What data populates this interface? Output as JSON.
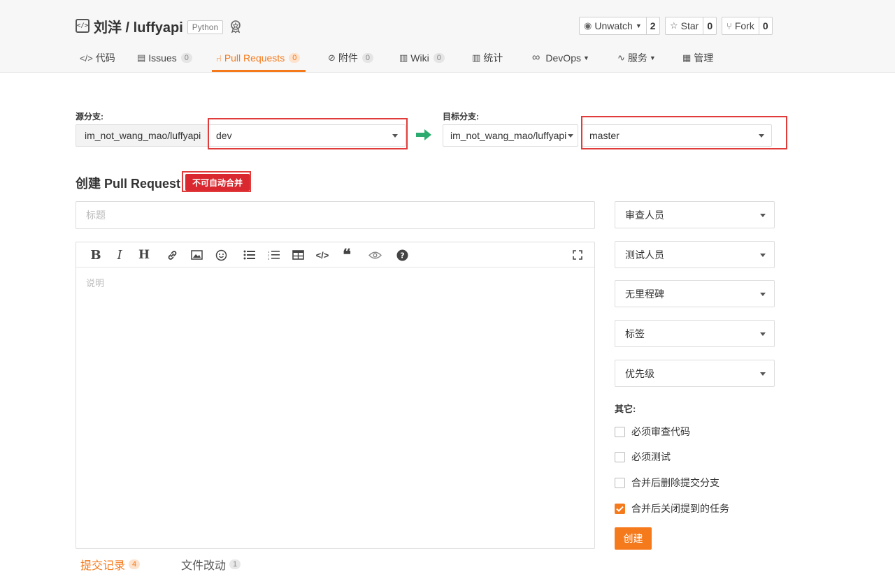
{
  "repo": {
    "owner_name": "刘洋 / luffyapi",
    "language": "Python",
    "icon": "code-bracket-icon",
    "award_icon": "award-ribbon-icon"
  },
  "actions": {
    "watch": {
      "label": "Unwatch",
      "count": "2",
      "icon": "eye-icon"
    },
    "star": {
      "label": "Star",
      "count": "0",
      "icon": "star-icon"
    },
    "fork": {
      "label": "Fork",
      "count": "0",
      "icon": "fork-icon"
    }
  },
  "nav": [
    {
      "label": "代码",
      "icon": "code-icon"
    },
    {
      "label": "Issues",
      "badge": "0",
      "icon": "issues-icon"
    },
    {
      "label": "Pull Requests",
      "badge": "0",
      "icon": "pull-request-icon",
      "active": true
    },
    {
      "label": "附件",
      "badge": "0",
      "icon": "paperclip-icon"
    },
    {
      "label": "Wiki",
      "badge": "0",
      "icon": "book-icon"
    },
    {
      "label": "统计",
      "icon": "bar-chart-icon"
    },
    {
      "label": "DevOps",
      "icon": "infinity-icon"
    },
    {
      "label": "服务",
      "icon": "pulse-icon"
    },
    {
      "label": "管理",
      "icon": "document-icon"
    }
  ],
  "branches": {
    "source_label": "源分支:",
    "source_repo": "im_not_wang_mao/luffyapi",
    "source_branch": "dev",
    "target_label": "目标分支:",
    "target_repo": "im_not_wang_mao/luffyapi",
    "target_branch": "master"
  },
  "form": {
    "heading": "创建 Pull Request",
    "merge_status": "不可自动合并",
    "title_placeholder": "标题",
    "description_placeholder": "说明"
  },
  "toolbar": [
    "bold-icon",
    "italic-icon",
    "heading-icon",
    "link-icon",
    "image-icon",
    "emoji-icon",
    "bullet-list-icon",
    "numbered-list-icon",
    "table-icon",
    "code-icon",
    "quote-icon",
    "preview-eye-icon",
    "help-icon",
    "fullscreen-icon"
  ],
  "sidebar": {
    "reviewers": "审查人员",
    "testers": "测试人员",
    "milestone": "无里程碑",
    "labels": "标签",
    "priority": "优先级",
    "other_label": "其它:",
    "options": [
      {
        "label": "必须审查代码",
        "checked": false
      },
      {
        "label": "必须测试",
        "checked": false
      },
      {
        "label": "合并后删除提交分支",
        "checked": false
      },
      {
        "label": "合并后关闭提到的任务",
        "checked": true
      }
    ],
    "create_label": "创建"
  },
  "bottom_tabs": [
    {
      "label": "提交记录",
      "badge": "4",
      "active": true
    },
    {
      "label": "文件改动",
      "badge": "1",
      "active": false
    }
  ],
  "colors": {
    "accent": "#f57a1c",
    "danger": "#d9282f",
    "arrow": "#2bab70"
  }
}
